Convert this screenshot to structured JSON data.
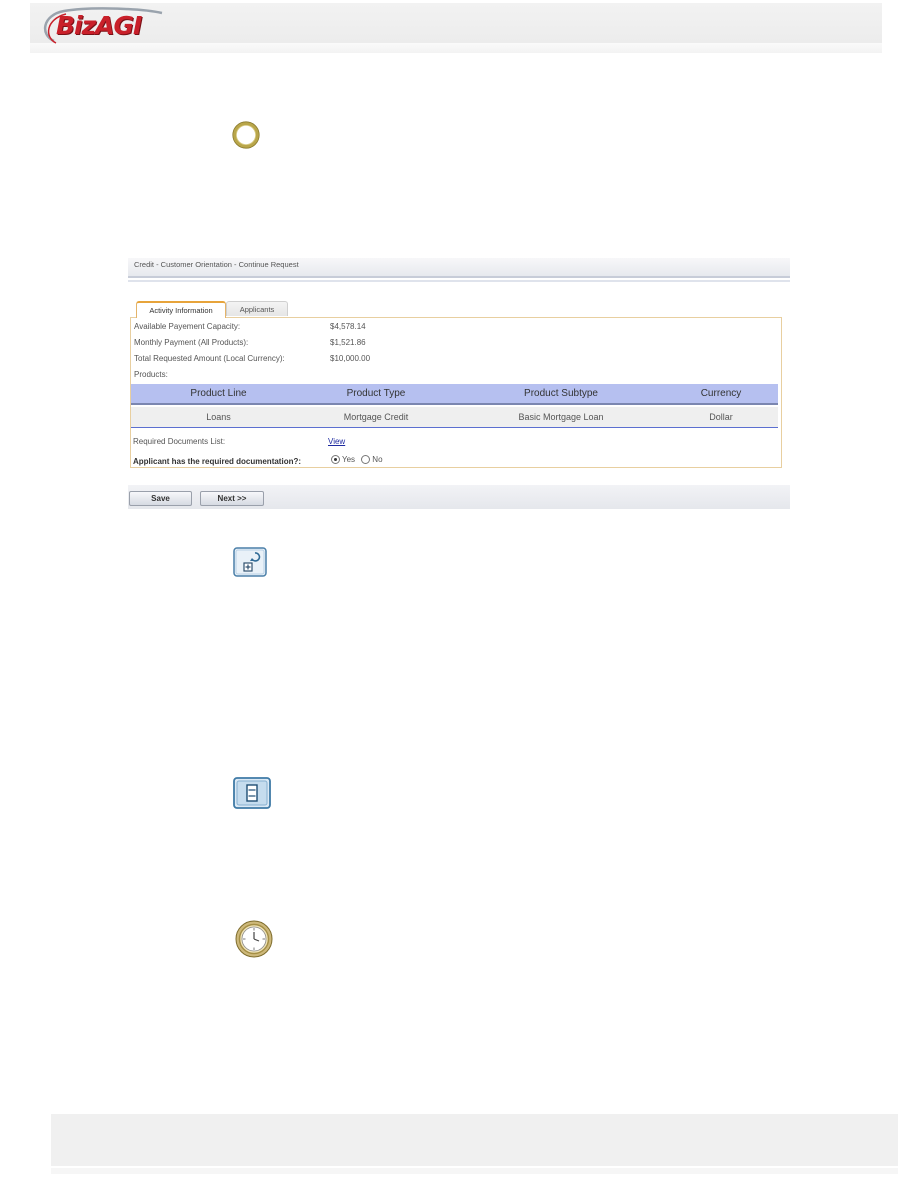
{
  "header": {
    "logo_text": "BizAGI"
  },
  "icons": [
    {
      "name": "start-event-icon"
    },
    {
      "name": "subprocess-icon"
    },
    {
      "name": "task-icon"
    },
    {
      "name": "timer-event-icon"
    }
  ],
  "screen": {
    "title": "Credit - Customer Orientation - Continue Request",
    "tabs": [
      {
        "label": "Activity Information",
        "active": true
      },
      {
        "label": "Applicants",
        "active": false
      }
    ],
    "fields": [
      {
        "label": "Available Payement Capacity:",
        "value": "$4,578.14"
      },
      {
        "label": "Monthly Payment (All Products):",
        "value": "$1,521.86"
      },
      {
        "label": "Total Requested Amount (Local Currency):",
        "value": "$10,000.00"
      },
      {
        "label": "Products:",
        "value": ""
      }
    ],
    "products_table": {
      "columns": [
        "Product Line",
        "Product Type",
        "Product Subtype",
        "Currency"
      ],
      "rows": [
        [
          "Loans",
          "Mortgage Credit",
          "Basic Mortgage Loan",
          "Dollar"
        ]
      ]
    },
    "required_docs": {
      "label": "Required Documents List:",
      "link": "View"
    },
    "question": {
      "label": "Applicant has the required documentation?:",
      "options": [
        {
          "label": "Yes",
          "selected": true
        },
        {
          "label": "No",
          "selected": false
        }
      ]
    },
    "buttons": {
      "save": "Save",
      "next": "Next >>"
    }
  },
  "colors": {
    "logo_red": "#c9202a",
    "grid_header": "#b6c0f0",
    "tab_accent": "#e7a43b"
  }
}
